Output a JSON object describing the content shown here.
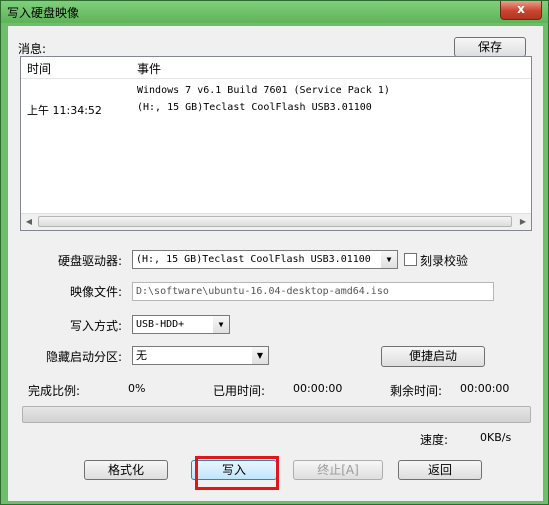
{
  "window": {
    "title": "写入硬盘映像",
    "close_glyph": "x"
  },
  "messages": {
    "label": "消息:",
    "save_button": "保存",
    "columns": {
      "time": "时间",
      "event": "事件"
    },
    "rows": [
      {
        "time": "",
        "event": "Windows 7 v6.1 Build 7601 (Service Pack 1)"
      },
      {
        "time": "上午 11:34:52",
        "event": "(H:, 15 GB)Teclast CoolFlash USB3.01100"
      }
    ]
  },
  "form": {
    "drive_label": "硬盘驱动器:",
    "drive_value": "(H:, 15 GB)Teclast CoolFlash USB3.01100",
    "verify_label": "刻录校验",
    "verify_checked": false,
    "image_label": "映像文件:",
    "image_value": "D:\\software\\ubuntu-16.04-desktop-amd64.iso",
    "write_mode_label": "写入方式:",
    "write_mode_value": "USB-HDD+",
    "hidden_partition_label": "隐藏启动分区:",
    "hidden_partition_value": "无",
    "quick_boot_button": "便捷启动"
  },
  "status": {
    "complete_label": "完成比例:",
    "complete_value": "0%",
    "elapsed_label": "已用时间:",
    "elapsed_value": "00:00:00",
    "remaining_label": "剩余时间:",
    "remaining_value": "00:00:00",
    "progress_fraction": 0,
    "speed_label": "速度:",
    "speed_value": "0KB/s"
  },
  "buttons": {
    "format": "格式化",
    "write": "写入",
    "abort": "终止[A]",
    "back": "返回"
  },
  "colors": {
    "highlight": "#e0161a",
    "titlebar": "#6fbe6a"
  }
}
